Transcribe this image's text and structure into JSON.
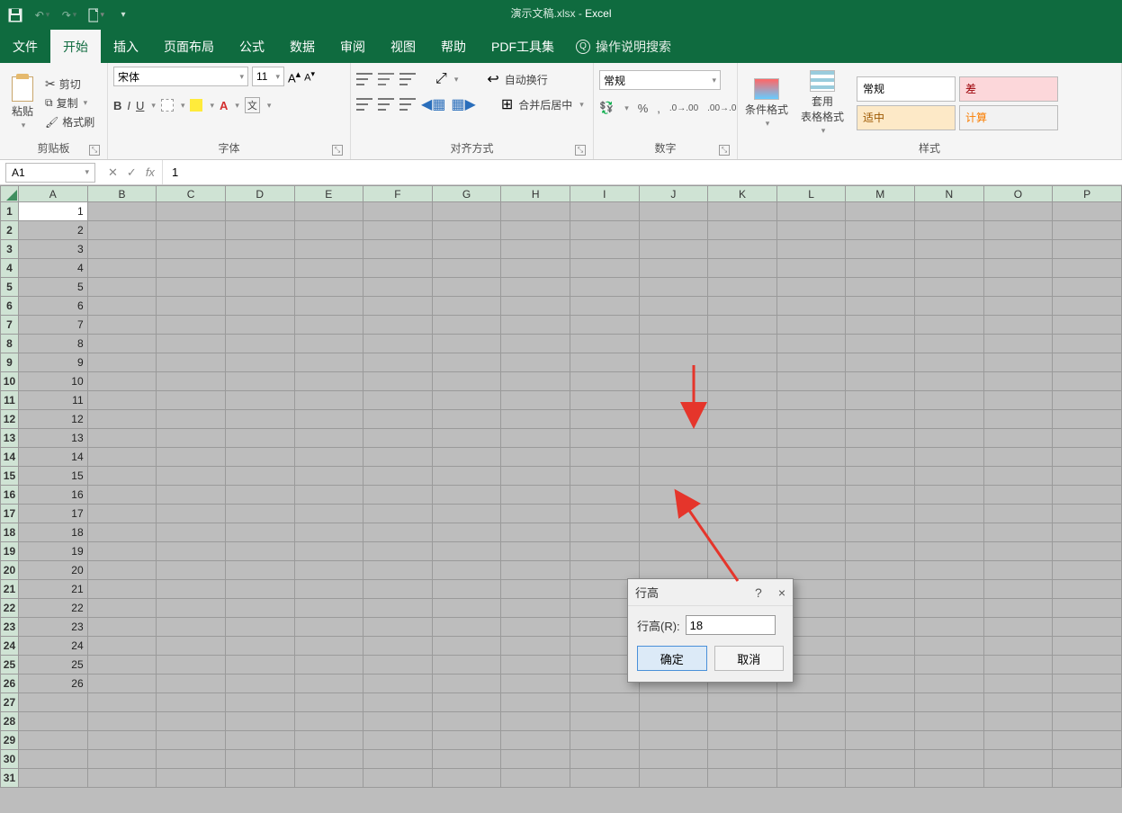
{
  "app": {
    "title": "演示文稿.xlsx",
    "sep": " - ",
    "name": "Excel"
  },
  "qat": {
    "save": "保存",
    "undo": "撤销",
    "redo": "重做",
    "new": "新建"
  },
  "tabs": {
    "file": "文件",
    "home": "开始",
    "insert": "插入",
    "layout": "页面布局",
    "formula": "公式",
    "data": "数据",
    "review": "审阅",
    "view": "视图",
    "help": "帮助",
    "pdf": "PDF工具集",
    "tellme": "操作说明搜索"
  },
  "ribbon": {
    "clipboard": {
      "label": "剪贴板",
      "paste": "粘贴",
      "cut": "剪切",
      "copy": "复制",
      "format": "格式刷"
    },
    "font": {
      "label": "字体",
      "name": "宋体",
      "size": "11"
    },
    "align": {
      "label": "对齐方式",
      "wrap": "自动换行",
      "merge": "合并后居中"
    },
    "number": {
      "label": "数字",
      "format": "常规"
    },
    "styles": {
      "label": "样式",
      "cond": "条件格式",
      "table": "套用\n表格格式",
      "normal": "常规",
      "bad": "差",
      "good": "适中",
      "calc": "计算"
    }
  },
  "formulabar": {
    "cell": "A1",
    "value": "1"
  },
  "columns": [
    "A",
    "B",
    "C",
    "D",
    "E",
    "F",
    "G",
    "H",
    "I",
    "J",
    "K",
    "L",
    "M",
    "N",
    "O",
    "P"
  ],
  "rows": [
    1,
    2,
    3,
    4,
    5,
    6,
    7,
    8,
    9,
    10,
    11,
    12,
    13,
    14,
    15,
    16,
    17,
    18,
    19,
    20,
    21,
    22,
    23,
    24,
    25,
    26,
    27,
    28,
    29,
    30,
    31
  ],
  "cells": {
    "A": {
      "1": "1",
      "2": "2",
      "3": "3",
      "4": "4",
      "5": "5",
      "6": "6",
      "7": "7",
      "8": "8",
      "9": "9",
      "10": "10",
      "11": "11",
      "12": "12",
      "13": "13",
      "14": "14",
      "15": "15",
      "16": "16",
      "17": "17",
      "18": "18",
      "19": "19",
      "20": "20",
      "21": "21",
      "22": "22",
      "23": "23",
      "24": "24",
      "25": "25",
      "26": "26"
    }
  },
  "dialog": {
    "title": "行高",
    "help": "?",
    "close": "×",
    "label": "行高(R):",
    "value": "18",
    "ok": "确定",
    "cancel": "取消"
  }
}
